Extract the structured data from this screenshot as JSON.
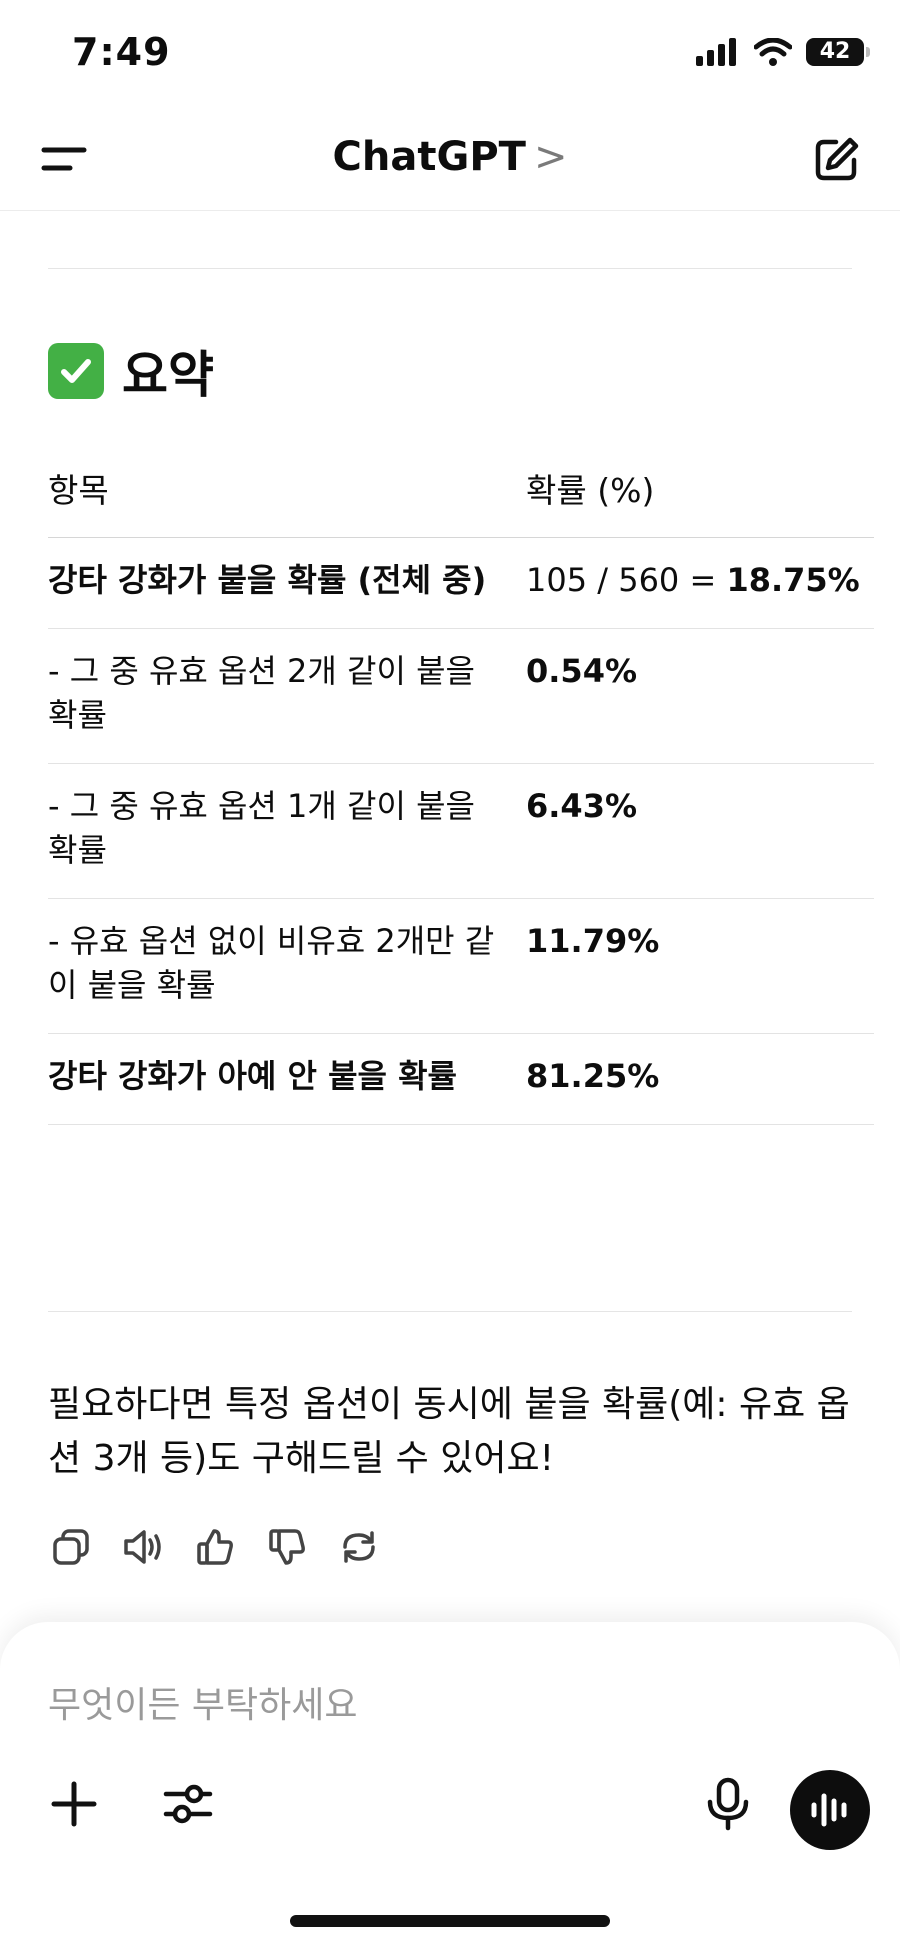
{
  "status": {
    "time": "7:49",
    "battery": "42"
  },
  "nav": {
    "title": "ChatGPT",
    "chevron": ">"
  },
  "summary": {
    "heading": "요약",
    "table": {
      "headers": [
        "항목",
        "확률 (%)"
      ],
      "rows": [
        {
          "item": "강타 강화가 붙을 확률 (전체 중)",
          "value_prefix": "105 / 560 = ",
          "value": "18.75%"
        },
        {
          "item": "- 그 중 유효 옵션 2개 같이 붙을 확률",
          "value_prefix": "",
          "value": "0.54%"
        },
        {
          "item": "- 그 중 유효 옵션 1개 같이 붙을 확률",
          "value_prefix": "",
          "value": "6.43%"
        },
        {
          "item": "- 유효 옵션 없이 비유효 2개만 같이 붙을 확률",
          "value_prefix": "",
          "value": "11.79%"
        },
        {
          "item": "강타 강화가 아예 안 붙을 확률",
          "value_prefix": "",
          "value": "81.25%"
        }
      ]
    },
    "footer": "필요하다면 특정 옵션이 동시에 붙을 확률(예: 유효 옵션 3개 등)도 구해드릴 수 있어요!"
  },
  "composer": {
    "placeholder": "무엇이든 부탁하세요"
  },
  "icons": {
    "accent": "#0d0d0d",
    "check_color": "#43b045"
  }
}
